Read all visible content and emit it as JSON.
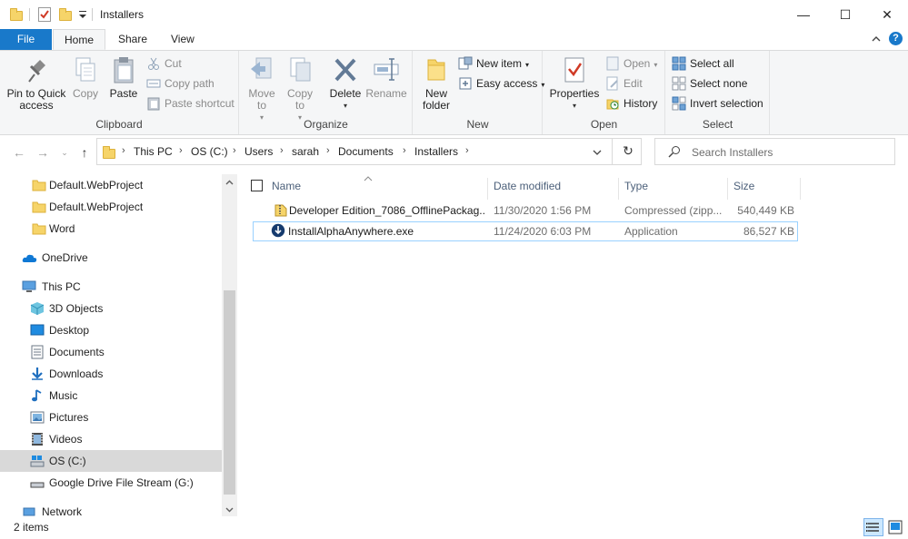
{
  "window": {
    "title": "Installers",
    "minimize_symbol": "—",
    "maximize_symbol": "☐",
    "close_symbol": "✕"
  },
  "tabs": {
    "file": "File",
    "home": "Home",
    "share": "Share",
    "view": "View"
  },
  "ribbon": {
    "clipboard": {
      "label": "Clipboard",
      "pin_label": "Pin to Quick access",
      "copy_label": "Copy",
      "paste_label": "Paste",
      "cut_label": "Cut",
      "copy_path_label": "Copy path",
      "paste_shortcut_label": "Paste shortcut"
    },
    "organize": {
      "label": "Organize",
      "move_to_label": "Move to",
      "copy_to_label": "Copy to",
      "delete_label": "Delete",
      "rename_label": "Rename"
    },
    "new": {
      "label": "New",
      "new_folder_label": "New folder",
      "new_item_label": "New item",
      "easy_access_label": "Easy access"
    },
    "open": {
      "label": "Open",
      "properties_label": "Properties",
      "open_label": "Open",
      "edit_label": "Edit",
      "history_label": "History"
    },
    "select": {
      "label": "Select",
      "select_all_label": "Select all",
      "select_none_label": "Select none",
      "invert_label": "Invert selection"
    }
  },
  "address": {
    "crumbs": [
      "This PC",
      "OS (C:)",
      "Users",
      "sarah",
      "Documents",
      "Installers"
    ]
  },
  "search": {
    "placeholder": "Search Installers"
  },
  "nav": {
    "items": [
      {
        "label": "Default.WebProject",
        "icon": "folder-icon"
      },
      {
        "label": "Default.WebProject",
        "icon": "folder-icon"
      },
      {
        "label": "Word",
        "icon": "folder-icon"
      },
      {
        "label": "OneDrive",
        "icon": "cloud-icon"
      },
      {
        "label": "This PC",
        "icon": "computer-icon"
      },
      {
        "label": "3D Objects",
        "icon": "cube-icon"
      },
      {
        "label": "Desktop",
        "icon": "desktop-icon"
      },
      {
        "label": "Documents",
        "icon": "document-icon"
      },
      {
        "label": "Downloads",
        "icon": "download-icon"
      },
      {
        "label": "Music",
        "icon": "music-icon"
      },
      {
        "label": "Pictures",
        "icon": "pictures-icon"
      },
      {
        "label": "Videos",
        "icon": "video-icon"
      },
      {
        "label": "OS (C:)",
        "icon": "drive-icon"
      },
      {
        "label": "Google Drive File Stream (G:)",
        "icon": "drive-icon"
      },
      {
        "label": "Network",
        "icon": "network-icon"
      }
    ]
  },
  "columns": {
    "name": "Name",
    "date": "Date modified",
    "type": "Type",
    "size": "Size"
  },
  "files": [
    {
      "name": "Developer Edition_7086_OfflinePackag...",
      "date": "11/30/2020 1:56 PM",
      "type": "Compressed (zipp...",
      "size": "540,449 KB",
      "icon": "zip-icon"
    },
    {
      "name": "InstallAlphaAnywhere.exe",
      "date": "11/24/2020 6:03 PM",
      "type": "Application",
      "size": "86,527 KB",
      "icon": "installer-icon"
    }
  ],
  "status": {
    "items": "2 items"
  }
}
